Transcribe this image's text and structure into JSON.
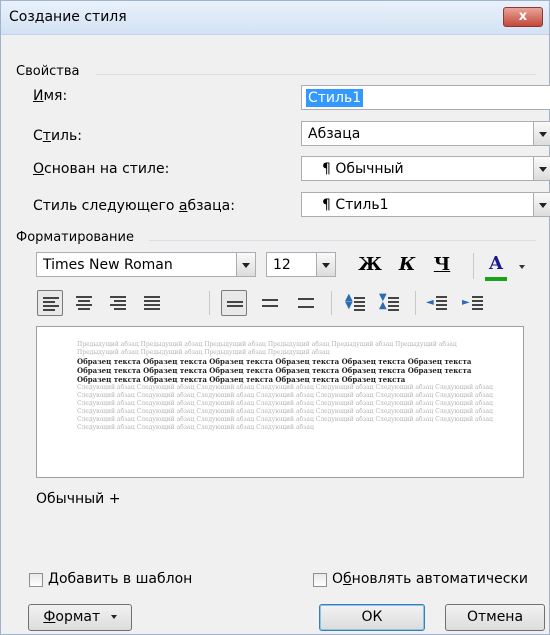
{
  "dialog": {
    "title": "Создание стиля",
    "close_label": "x"
  },
  "properties": {
    "group_label": "Свойства",
    "name_label": "Имя:",
    "name_value": "Стиль1",
    "style_type_label": "Стиль:",
    "style_type_value": "Абзаца",
    "based_on_label": "Основан на стиле:",
    "based_on_value": "¶ Обычный",
    "next_style_label": "Стиль следующего абзаца:",
    "next_style_value": "¶ Стиль1"
  },
  "formatting": {
    "group_label": "Форматирование",
    "font_name": "Times New Roman",
    "font_size": "12",
    "bold_label": "Ж",
    "italic_label": "К",
    "underline_label": "Ч",
    "font_color_label": "A",
    "font_color": "#19a319"
  },
  "preview": {
    "prev_text": "Предыдущий абзац Предыдущий абзац Предыдущий абзац Предыдущий абзац Предыдущий абзац Предыдущий абзац Предыдущий абзац Предыдущий абзац Предыдущий абзац Предыдущий абзац",
    "sample_text": "Образец текста Образец текста Образец текста Образец текста Образец текста Образец текста Образец текста Образец текста Образец текста Образец текста Образец текста Образец текста Образец текста Образец текста Образец текста Образец текста Образец текста",
    "next_text": "Следующий абзац Следующий абзац Следующий абзац Следующий абзац Следующий абзац Следующий абзац Следующий абзац Следующий абзац Следующий абзац Следующий абзац Следующий абзац Следующий абзац Следующий абзац Следующий абзац Следующий абзац Следующий абзац Следующий абзац Следующий абзац Следующий абзац Следующий абзац Следующий абзац Следующий абзац Следующий абзац Следующий абзац Следующий абзац Следующий абзац Следующий абзац Следующий абзац Следующий абзац Следующий абзац Следующий абзац Следующий абзац Следующий абзац Следующий абзац Следующий абзац Следующий абзац Следующий абзац Следующий абзац Следующий абзац"
  },
  "description": "Обычный +",
  "options": {
    "add_to_template": "Добавить в шаблон",
    "auto_update": "Обновлять автоматически"
  },
  "buttons": {
    "format": "Формат",
    "ok": "ОК",
    "cancel": "Отмена"
  }
}
